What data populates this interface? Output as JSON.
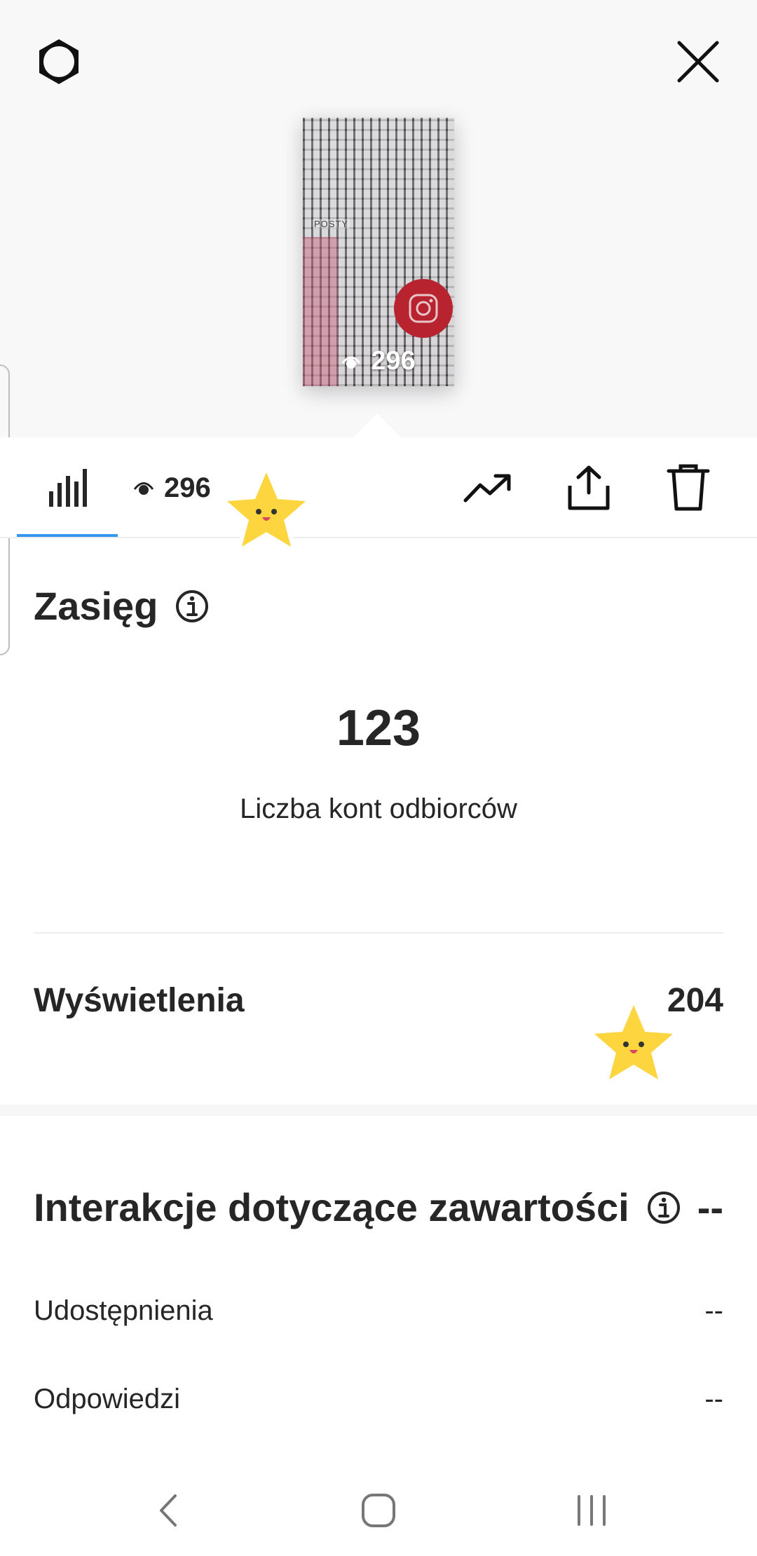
{
  "header": {
    "settings_icon": "gear-icon",
    "close_icon": "close-icon"
  },
  "thumbnail": {
    "overlay_text": "POSTY",
    "views": "296",
    "icon": "eye-icon"
  },
  "tabs": {
    "insights_icon": "bar-chart-icon",
    "viewers_count": "296",
    "promote_icon": "trending-up-icon",
    "share_icon": "share-icon",
    "delete_icon": "trash-icon",
    "active_color": "#3797f0"
  },
  "reach": {
    "title": "Zasięg",
    "value": "123",
    "label": "Liczba kont odbiorców"
  },
  "impressions": {
    "label": "Wyświetlenia",
    "value": "204"
  },
  "interactions": {
    "title": "Interakcje dotyczące zawartości",
    "value": "--",
    "rows": [
      {
        "label": "Udostępnienia",
        "value": "--"
      },
      {
        "label": "Odpowiedzi",
        "value": "--"
      }
    ]
  },
  "navbar": {
    "back_icon": "back-icon",
    "home_icon": "home-icon",
    "recents_icon": "recents-icon"
  },
  "colors": {
    "accent": "#3797f0",
    "text": "#262626",
    "sticker": "#fcd53f"
  }
}
